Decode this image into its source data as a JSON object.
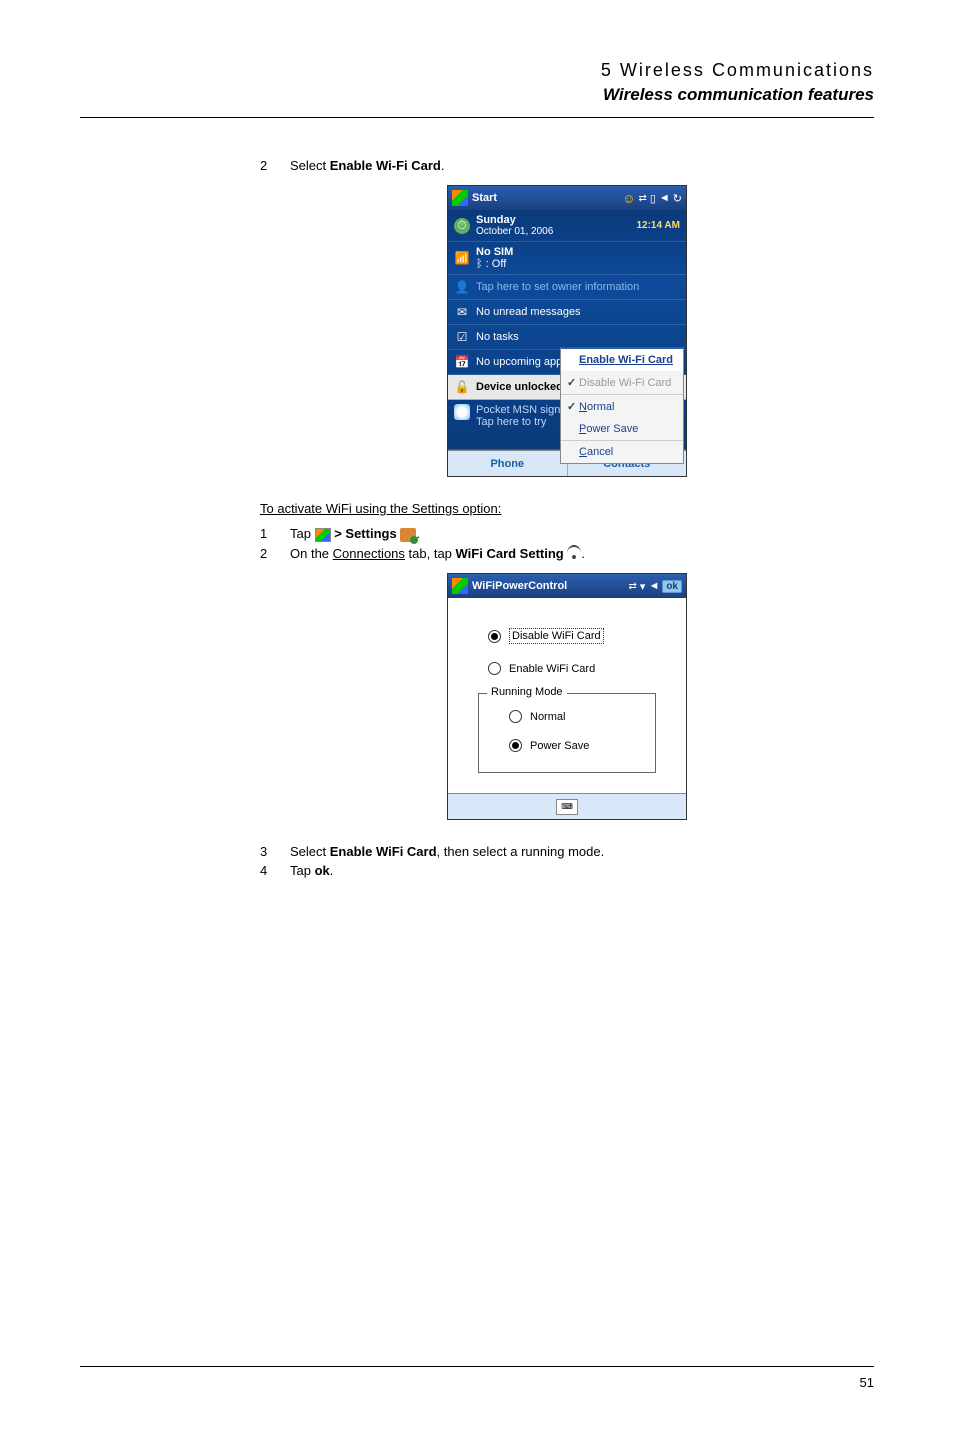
{
  "header": {
    "chapter": "5 Wireless Communications",
    "section": "Wireless communication features"
  },
  "steps1": {
    "s2_num": "2",
    "s2_prefix": "Select ",
    "s2_bold": "Enable Wi-Fi Card",
    "s2_suffix": "."
  },
  "screenshot1": {
    "titlebar": "Start",
    "day": "Sunday",
    "date": "October 01, 2006",
    "time": "12:14 AM",
    "no_sim": "No SIM",
    "bt_off": ": Off",
    "owner": "Tap here to set owner information",
    "messages": "No unread messages",
    "tasks": "No tasks",
    "appointments": "No upcoming appointments",
    "unlocked": "Device unlocked",
    "msn_label": "Pocket MSN sign",
    "msn_tap": "Tap here to try",
    "menu": {
      "enable": "Enable Wi-Fi Card",
      "disable": "Disable Wi-Fi Card",
      "normal_pre": "N",
      "normal_rest": "ormal",
      "power_pre": "P",
      "power_rest": "ower Save",
      "cancel_pre": "C",
      "cancel_rest": "ancel"
    },
    "softkeys": {
      "left": "Phone",
      "right": "Contacts"
    }
  },
  "subsection": "To activate WiFi using the Settings option:",
  "steps2": {
    "s1_num": "1",
    "s1_prefix": "Tap ",
    "s1_middle": " > ",
    "s1_bold": "Settings",
    "s1_suffix": " .",
    "s2_num": "2",
    "s2_prefix": "On the ",
    "s2_link": "Connections",
    "s2_middle": " tab, tap ",
    "s2_bold": "WiFi Card Setting",
    "s2_suffix": " ."
  },
  "screenshot2": {
    "titlebar": "WiFiPowerControl",
    "ok": "ok",
    "disable": "Disable WiFi Card",
    "enable": "Enable WiFi Card",
    "legend": "Running Mode",
    "normal": "Normal",
    "powersave": "Power Save"
  },
  "steps3": {
    "s3_num": "3",
    "s3_prefix": "Select ",
    "s3_bold": "Enable WiFi Card",
    "s3_suffix": ", then select a running mode.",
    "s4_num": "4",
    "s4_prefix": "Tap ",
    "s4_bold": "ok",
    "s4_suffix": "."
  },
  "page_number": "51"
}
